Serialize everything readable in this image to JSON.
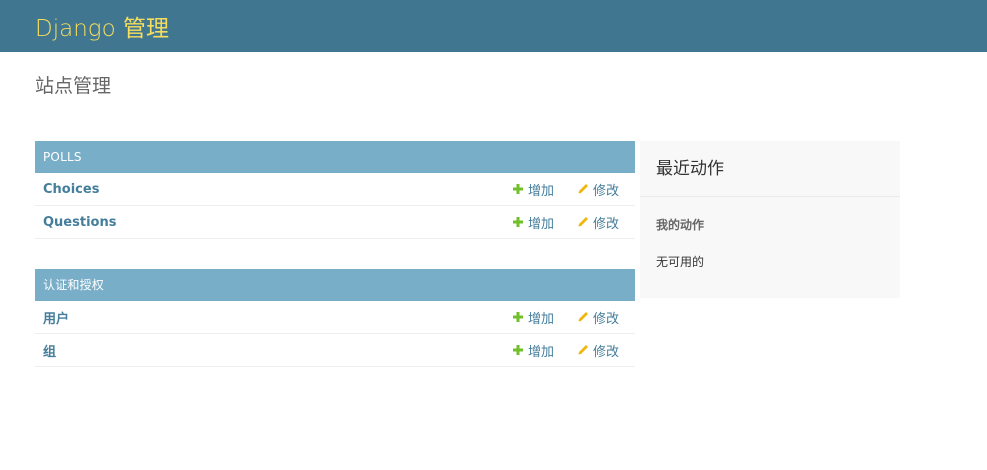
{
  "header": {
    "brand": "Django 管理"
  },
  "page": {
    "title": "站点管理"
  },
  "apps": [
    {
      "caption": "POLLS",
      "models": [
        {
          "name": "Choices",
          "add_label": "增加",
          "change_label": "修改"
        },
        {
          "name": "Questions",
          "add_label": "增加",
          "change_label": "修改"
        }
      ]
    },
    {
      "caption": "认证和授权",
      "models": [
        {
          "name": "用户",
          "add_label": "增加",
          "change_label": "修改"
        },
        {
          "name": "组",
          "add_label": "增加",
          "change_label": "修改"
        }
      ]
    }
  ],
  "sidebar": {
    "title": "最近动作",
    "my_actions_title": "我的动作",
    "empty_text": "无可用的"
  },
  "icons": {
    "add": "plus-icon",
    "change": "pencil-icon"
  },
  "colors": {
    "header_bg": "#417690",
    "brand": "#f5dd5d",
    "caption_bg": "#79aec8",
    "link": "#447e9b",
    "add_icon": "#70bf2b",
    "change_icon": "#efb80b"
  }
}
